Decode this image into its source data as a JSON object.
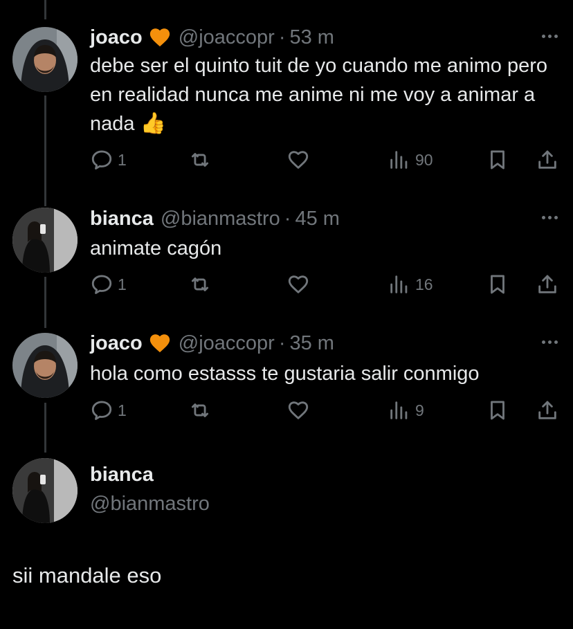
{
  "tweets": [
    {
      "name": "joaco",
      "handle": "@joaccopr",
      "dot": "·",
      "time": "53 m",
      "text": "debe ser el quinto tuit de yo cuando me animo pero en realidad nunca me anime ni me voy a animar a nada",
      "emoji": "👍",
      "replies": "1",
      "views": "90"
    },
    {
      "name": "bianca",
      "handle": "@bianmastro",
      "dot": "·",
      "time": "45 m",
      "text": "animate cagón",
      "replies": "1",
      "views": "16"
    },
    {
      "name": "joaco",
      "handle": "@joaccopr",
      "dot": "·",
      "time": "35 m",
      "text": "hola como estasss te gustaria salir conmigo",
      "replies": "1",
      "views": "9"
    }
  ],
  "focused": {
    "name": "bianca",
    "handle": "@bianmastro",
    "text": "sii mandale eso"
  },
  "colors": {
    "background": "#000000",
    "text": "#e7e9ea",
    "muted": "#71767b",
    "heart_badge": "#f4900c",
    "line": "#333639"
  },
  "icons": [
    "orange-heart-icon",
    "more-icon",
    "reply-icon",
    "retweet-icon",
    "like-icon",
    "views-icon",
    "bookmark-icon",
    "share-icon"
  ]
}
